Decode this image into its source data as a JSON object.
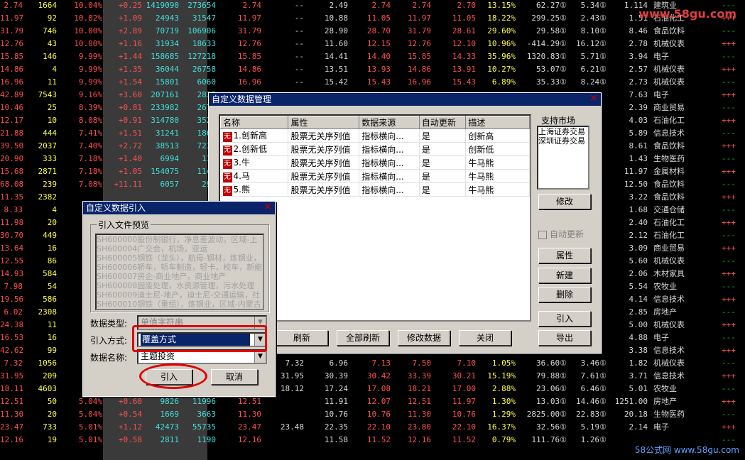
{
  "background_rows": [
    [
      "2.74",
      "1664",
      "10.04%",
      "+0.25",
      "1419090",
      "273654",
      "2.74",
      "--",
      "2.49",
      "2.74",
      "2.74",
      "2.70",
      "13.15%",
      "62.27①",
      "5.34①",
      "1.114",
      "建筑业"
    ],
    [
      "11.97",
      "92",
      "10.02%",
      "+1.09",
      "24943",
      "31547",
      "11.97",
      "--",
      "10.88",
      "11.05",
      "11.97",
      "11.05",
      "18.22%",
      "299.25①",
      "2.43①",
      "1.51",
      "石油化工"
    ],
    [
      "31.79",
      "746",
      "10.00%",
      "+2.89",
      "70719",
      "106906",
      "31.79",
      "--",
      "28.90",
      "28.70",
      "31.79",
      "28.61",
      "29.60%",
      "29.58①",
      "8.10①",
      "8.46",
      "食品饮料"
    ],
    [
      "12.76",
      "43",
      "10.00%",
      "+1.16",
      "31934",
      "18633",
      "12.76",
      "--",
      "11.60",
      "12.15",
      "12.76",
      "12.10",
      "10.96%",
      "-414.29①",
      "16.12①",
      "2.78",
      "机械仪表"
    ],
    [
      "15.85",
      "146",
      "9.99%",
      "+1.44",
      "158685",
      "127218",
      "15.85",
      "--",
      "14.41",
      "14.40",
      "15.85",
      "14.33",
      "35.96%",
      "1320.83①",
      "5.71①",
      "3.94",
      "电子"
    ],
    [
      "14.86",
      "4",
      "9.99%",
      "+1.35",
      "36044",
      "26758",
      "14.86",
      "--",
      "13.51",
      "13.93",
      "14.86",
      "13.91",
      "10.27%",
      "53.07①",
      "6.21①",
      "2.57",
      "机械仪表"
    ],
    [
      "16.96",
      "11",
      "9.99%",
      "+1.54",
      "15801",
      "6060",
      "16.96",
      "--",
      "15.42",
      "15.43",
      "16.96",
      "15.43",
      "6.89%",
      "35.33①",
      "8.24①",
      "2.73",
      "机械仪表"
    ],
    [
      "42.89",
      "7543",
      "9.16%",
      "+3.60",
      "207161",
      "2835",
      "",
      "",
      "",
      "",
      "",
      "",
      "",
      "",
      "",
      "7.63",
      "电子"
    ],
    [
      "10.46",
      "25",
      "8.39%",
      "+0.81",
      "233982",
      "2676",
      "",
      "",
      "",
      "",
      "",
      "",
      "",
      "",
      "",
      "2.39",
      "商业贸易"
    ],
    [
      "12.17",
      "10",
      "8.08%",
      "+0.91",
      "314780",
      "3527",
      "",
      "",
      "",
      "",
      "",
      "",
      "",
      "",
      "",
      "4.03",
      "石油化工"
    ],
    [
      "21.88",
      "444",
      "7.41%",
      "+1.51",
      "31241",
      "1867",
      "",
      "",
      "",
      "",
      "",
      "",
      "",
      "",
      "",
      "5.89",
      "信息技术"
    ],
    [
      "39.50",
      "2037",
      "7.40%",
      "+2.72",
      "38513",
      "7232",
      "",
      "",
      "",
      "",
      "",
      "",
      "",
      "",
      "",
      "8.61",
      "食品饮料"
    ],
    [
      "20.90",
      "333",
      "7.18%",
      "+1.40",
      "6994",
      "111",
      "",
      "",
      "",
      "",
      "",
      "",
      "",
      "",
      "",
      "1.43",
      "生物医药"
    ],
    [
      "15.68",
      "2871",
      "7.18%",
      "+1.05",
      "154075",
      "1143",
      "",
      "",
      "",
      "",
      "",
      "",
      "",
      "",
      "",
      "11.97",
      "金属材料"
    ],
    [
      "68.08",
      "239",
      "7.08%",
      "+11.11",
      "6057",
      "293",
      "",
      "",
      "",
      "",
      "",
      "",
      "",
      "",
      "",
      "12.50",
      "食品饮料"
    ],
    [
      "11.35",
      "2382",
      "",
      "",
      "",
      "",
      "",
      "",
      "",
      "",
      "",
      "",
      "",
      "",
      "",
      "3.22",
      "食品饮料"
    ],
    [
      "8.33",
      "4",
      "",
      "",
      "",
      "",
      "",
      "",
      "",
      "",
      "",
      "",
      "",
      "",
      "",
      "1.68",
      "交通仓储"
    ],
    [
      "11.98",
      "20",
      "",
      "",
      "",
      "",
      "",
      "",
      "",
      "",
      "",
      "",
      "",
      "",
      "",
      "2.40",
      "石油化工"
    ],
    [
      "30.70",
      "449",
      "",
      "",
      "",
      "",
      "",
      "",
      "",
      "",
      "",
      "",
      "",
      "",
      "",
      "2.12",
      "石油化工"
    ],
    [
      "13.64",
      "16",
      "",
      "",
      "",
      "",
      "",
      "",
      "",
      "",
      "",
      "",
      "",
      "",
      "",
      "3.09",
      "商业贸易"
    ],
    [
      "12.55",
      "86",
      "",
      "",
      "",
      "",
      "",
      "",
      "",
      "",
      "",
      "",
      "",
      "",
      "",
      "5.60",
      "机械仪表"
    ],
    [
      "14.93",
      "584",
      "",
      "",
      "",
      "",
      "",
      "",
      "",
      "",
      "",
      "",
      "",
      "",
      "",
      "2.06",
      "木材家具"
    ],
    [
      "7.98",
      "54",
      "",
      "",
      "",
      "",
      "",
      "",
      "",
      "",
      "",
      "",
      "",
      "",
      "",
      "5.54",
      "农牧业"
    ],
    [
      "19.56",
      "586",
      "",
      "",
      "",
      "",
      "",
      "",
      "",
      "",
      "",
      "",
      "",
      "",
      "",
      "4.14",
      "信息技术"
    ],
    [
      "6.02",
      "2308",
      "",
      "",
      "",
      "",
      "",
      "",
      "",
      "",
      "",
      "",
      "",
      "",
      "",
      "2.85",
      "房地产"
    ],
    [
      "24.38",
      "11",
      "",
      "",
      "",
      "",
      "",
      "",
      "",
      "",
      "",
      "",
      "",
      "",
      "",
      "5.00",
      "机械仪表"
    ],
    [
      "16.53",
      "16",
      "",
      "",
      "",
      "",
      "",
      "",
      "",
      "",
      "",
      "",
      "",
      "",
      "",
      "4.88",
      "电子"
    ],
    [
      "42.62",
      "99",
      "",
      "",
      "",
      "",
      "",
      "",
      "",
      "",
      "",
      "",
      "",
      "",
      "",
      "3.38",
      "信息技术"
    ],
    [
      "7.32",
      "1056",
      "",
      "",
      "",
      "",
      "",
      "7.32",
      "6.96",
      "7.13",
      "7.50",
      "7.10",
      "1.05%",
      "36.60①",
      "3.46①",
      "1.82",
      "机械仪表"
    ],
    [
      "31.95",
      "209",
      "",
      "",
      "",
      "",
      "",
      "31.95",
      "30.39",
      "30.42",
      "33.39",
      "30.21",
      "15.19%",
      "79.88①",
      "7.61①",
      "3.71",
      "信息技术"
    ],
    [
      "18.11",
      "4603",
      "",
      "",
      "",
      "",
      "",
      "18.12",
      "17.24",
      "17.08",
      "18.21",
      "17.00",
      "2.88%",
      "23.06①",
      "6.46①",
      "5.01",
      "农牧业"
    ],
    [
      "12.51",
      "50",
      "5.04%",
      "+0.60",
      "9826",
      "11996",
      "12.51",
      "",
      "11.91",
      "12.07",
      "12.51",
      "11.97",
      "1.30%",
      "13.03①",
      "14.46①",
      "1251.00",
      "房地产"
    ],
    [
      "11.30",
      "20",
      "5.04%",
      "+0.54",
      "1669",
      "3663",
      "11.30",
      "",
      "10.76",
      "10.76",
      "11.30",
      "10.76",
      "1.29%",
      "2825.00①",
      "22.83①",
      "20.18",
      "生物医药"
    ],
    [
      "23.47",
      "733",
      "5.01%",
      "+1.12",
      "42473",
      "55735",
      "23.47",
      "23.48",
      "22.35",
      "22.10",
      "23.80",
      "22.10",
      "16.37%",
      "32.56①",
      "5.19①",
      "2.14",
      "电子"
    ],
    [
      "12.16",
      "19",
      "5.01%",
      "+0.58",
      "2811",
      "1190",
      "12.16",
      "",
      "11.58",
      "11.52",
      "12.16",
      "11.52",
      "0.79%",
      "111.76①",
      "1.26①",
      "",
      ""
    ]
  ],
  "watermark_top": "www.58gu.com",
  "watermark_bottom": "58公式网 www.58gu.com",
  "manager": {
    "title": "自定义数据管理",
    "columns": [
      "名称",
      "属性",
      "数据来源",
      "自动更新",
      "描述"
    ],
    "rows": [
      {
        "badge": "无",
        "name": "1.创新高",
        "attr": "股票无关序列值",
        "source": "指标横向...",
        "auto": "是",
        "desc": "创新高"
      },
      {
        "badge": "无",
        "name": "2.创新低",
        "attr": "股票无关序列值",
        "source": "指标横向...",
        "auto": "是",
        "desc": "创新低"
      },
      {
        "badge": "无",
        "name": "3.牛",
        "attr": "股票无关序列值",
        "source": "指标横向...",
        "auto": "是",
        "desc": "牛马熊"
      },
      {
        "badge": "无",
        "name": "4.马",
        "attr": "股票无关序列值",
        "source": "指标横向...",
        "auto": "是",
        "desc": "牛马熊"
      },
      {
        "badge": "无",
        "name": "5.熊",
        "attr": "股票无关序列值",
        "source": "指标横向...",
        "auto": "是",
        "desc": "牛马熊"
      }
    ],
    "market_label": "支持市场",
    "markets": [
      "上海证券交易",
      "深圳证券交易"
    ],
    "modify_label": "修改",
    "auto_update_label": "自动更新",
    "property_label": "属性",
    "new_label": "新建",
    "delete_label": "删除",
    "import_label": "引入",
    "export_label": "导出",
    "refresh_label": "刷新",
    "refresh_all_label": "全部刷新",
    "modify_data_label": "修改数据",
    "close_label": "关闭"
  },
  "importer": {
    "title": "自定义数据引入",
    "preview_label": "引入文件预览",
    "preview_lines": [
      "SH600000股份制银行，净息差波动，区域-上",
      "SH600004广交会，机场，亚运",
      "SH600005钢铁（龙头），航母-钢材，炼钢业，",
      "SH600006轿车，轿车制造，轻卡，校车，新能",
      "SH600007房企-商业地产，商业地产",
      "SH600008固废处理，水资源管理，污水处理",
      "SH600009迪士尼-地产，迪士尼-交通运输，社",
      "SH600010钢铁（重组），炼钢业，区域-内蒙古"
    ],
    "type_label": "数据类型:",
    "type_value": "单值字符串",
    "mode_label": "引入方式:",
    "mode_value": "覆盖方式",
    "name_label": "数据名称:",
    "name_value": "主题投资",
    "ok_label": "引入",
    "cancel_label": "取消"
  }
}
